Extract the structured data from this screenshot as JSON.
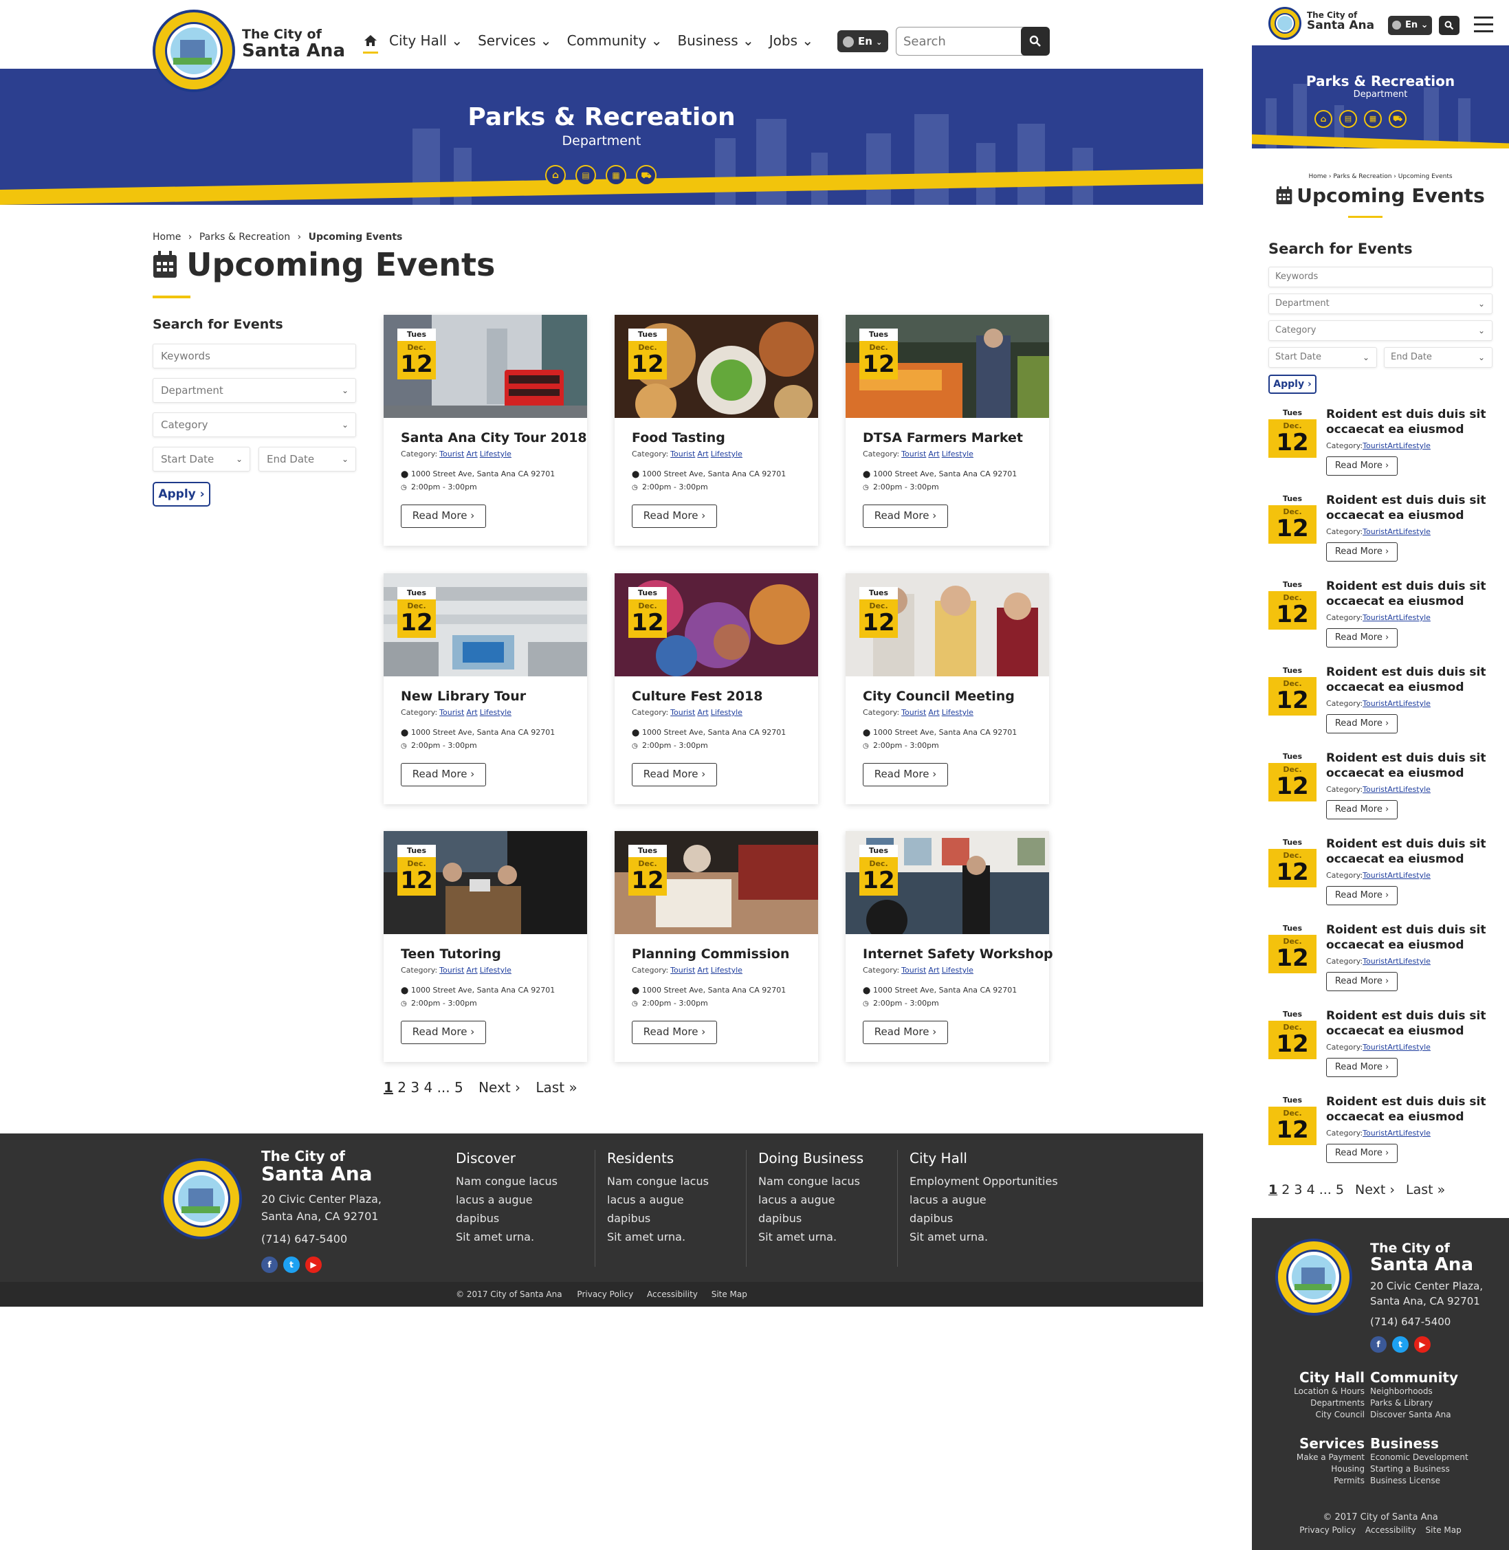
{
  "header": {
    "logo_line1": "The City of",
    "logo_line2": "Santa Ana",
    "nav": [
      {
        "label": "City Hall"
      },
      {
        "label": "Services"
      },
      {
        "label": "Community"
      },
      {
        "label": "Business"
      },
      {
        "label": "Jobs"
      }
    ],
    "lang": "En",
    "search_placeholder": "Search"
  },
  "banner": {
    "title": "Parks & Recreation",
    "subtitle": "Department",
    "icons": [
      "home-icon",
      "card-icon",
      "calendar-icon",
      "cart-icon"
    ]
  },
  "breadcrumb": [
    "Home",
    "Parks & Recreation",
    "Upcoming Events"
  ],
  "page_title": "Upcoming Events",
  "search_panel": {
    "title": "Search for Events",
    "keywords_placeholder": "Keywords",
    "department": "Department",
    "category": "Category",
    "start_date": "Start Date",
    "end_date": "End Date",
    "apply": "Apply"
  },
  "events": [
    {
      "day": "Tues",
      "month": "Dec.",
      "date": "12",
      "title": "Santa Ana City Tour 2018",
      "image": "street-bus"
    },
    {
      "day": "Tues",
      "month": "Dec.",
      "date": "12",
      "title": "Food Tasting",
      "image": "food"
    },
    {
      "day": "Tues",
      "month": "Dec.",
      "date": "12",
      "title": "DTSA Farmers Market",
      "image": "market"
    },
    {
      "day": "Tues",
      "month": "Dec.",
      "date": "12",
      "title": "New Library Tour",
      "image": "library"
    },
    {
      "day": "Tues",
      "month": "Dec.",
      "date": "12",
      "title": "Culture Fest 2018",
      "image": "festival"
    },
    {
      "day": "Tues",
      "month": "Dec.",
      "date": "12",
      "title": "City Council Meeting",
      "image": "meeting"
    },
    {
      "day": "Tues",
      "month": "Dec.",
      "date": "12",
      "title": "Teen Tutoring",
      "image": "tutoring"
    },
    {
      "day": "Tues",
      "month": "Dec.",
      "date": "12",
      "title": "Planning Commission",
      "image": "desk"
    },
    {
      "day": "Tues",
      "month": "Dec.",
      "date": "12",
      "title": "Internet Safety Workshop",
      "image": "gallery"
    }
  ],
  "event_common": {
    "category_label": "Category:",
    "categories": [
      "Tourist",
      "Art",
      "Lifestyle"
    ],
    "address": "1000 Street Ave, Santa Ana CA 92701",
    "time": "2:00pm - 3:00pm",
    "read_more": "Read More"
  },
  "pagination": {
    "pages": [
      "1",
      "2",
      "3",
      "4",
      "...",
      "5"
    ],
    "next": "Next",
    "last": "Last"
  },
  "footer": {
    "name_line1": "The City of",
    "name_line2": "Santa Ana",
    "address1": "20 Civic Center Plaza,",
    "address2": "Santa Ana, CA 92701",
    "phone": "(714) 647-5400",
    "columns": [
      {
        "title": "Discover",
        "lines": [
          "Nam congue lacus",
          "lacus a augue",
          "dapibus",
          "Sit amet urna."
        ]
      },
      {
        "title": "Residents",
        "lines": [
          "Nam congue lacus",
          "lacus a augue",
          "dapibus",
          "Sit amet urna."
        ]
      },
      {
        "title": "Doing Business",
        "lines": [
          "Nam congue lacus",
          "lacus a augue",
          "dapibus",
          "Sit amet urna."
        ]
      },
      {
        "title": "City Hall",
        "lines": [
          "Employment Opportunities",
          "lacus a augue",
          "dapibus",
          "Sit amet urna."
        ]
      }
    ],
    "copyright": "© 2017 City of Santa Ana",
    "links": [
      "Privacy Policy",
      "Accessibility",
      "Site Map"
    ]
  },
  "mobile": {
    "event_title": "Roident est duis duis sit occaecat ea eiusmod",
    "event_count": 9,
    "footer_groups": [
      {
        "title": "City Hall",
        "lines": [
          "Location & Hours",
          "Departments",
          "City Council"
        ]
      },
      {
        "title": "Community",
        "lines": [
          "Neighborhoods",
          "Parks & Library",
          "Discover Santa Ana"
        ]
      },
      {
        "title": "Services",
        "lines": [
          "Make a Payment",
          "Housing",
          "Permits"
        ]
      },
      {
        "title": "Business",
        "lines": [
          "Economic Development",
          "Starting a Business",
          "Business License"
        ]
      }
    ]
  },
  "colors": {
    "navy": "#2c3f8f",
    "yellow": "#f4c20d",
    "footer": "#333333",
    "link": "#1f3e9e"
  }
}
